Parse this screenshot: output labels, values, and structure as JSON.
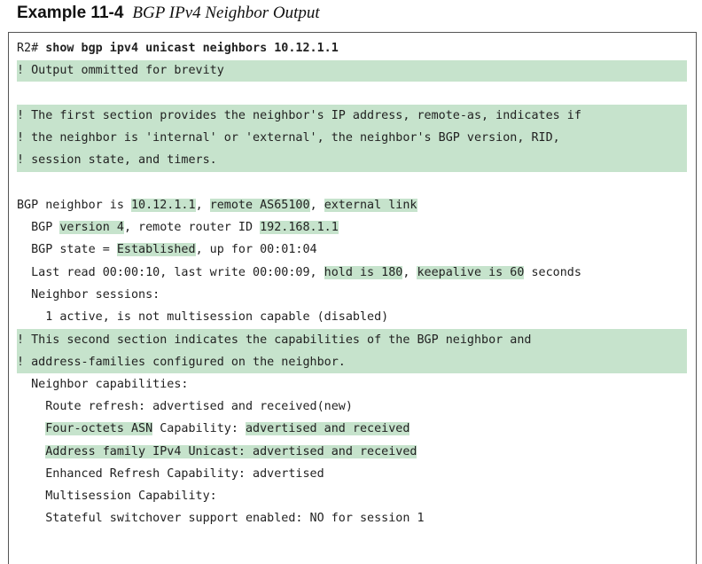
{
  "example": {
    "number": "Example 11-4",
    "caption": "BGP IPv4 Neighbor Output"
  },
  "colors": {
    "highlight": "#c6e3cc",
    "border": "#555555",
    "text": "#222222"
  },
  "terminal": {
    "prompt": "R2#",
    "command": "show bgp ipv4 unicast neighbors 10.12.1.1",
    "comment_omitted": "! Output ommitted for brevity",
    "comment_section1": [
      "! The first section provides the neighbor's IP address, remote-as, indicates if",
      "! the neighbor is 'internal' or 'external', the neighbor's BGP version, RID,",
      "! session state, and timers."
    ],
    "neighbor_line": {
      "prefix": "BGP neighbor is ",
      "ip": "10.12.1.1",
      "sep1": ", ",
      "remote_as": "remote AS65100",
      "sep2": ", ",
      "link": "external link"
    },
    "version_line": {
      "prefix": "  BGP ",
      "version": "version 4",
      "mid": ", remote router ID ",
      "rid": "192.168.1.1"
    },
    "state_line": {
      "prefix": "  BGP state = ",
      "state": "Established",
      "suffix": ", up for 00:01:04"
    },
    "timers_line": {
      "prefix": "  Last read 00:00:10, last write 00:00:09, ",
      "hold": "hold is 180",
      "sep": ", ",
      "keepalive": "keepalive is 60",
      "suffix": " seconds"
    },
    "sessions_label": "  Neighbor sessions:",
    "sessions_value": "    1 active, is not multisession capable (disabled)",
    "comment_section2": [
      "! This second section indicates the capabilities of the BGP neighbor and",
      "! address-families configured on the neighbor."
    ],
    "capabilities_label": "  Neighbor capabilities:",
    "route_refresh": "    Route refresh: advertised and received(new)",
    "four_octet": {
      "prefix": "    ",
      "name": "Four-octets ASN",
      "mid": " Capability: ",
      "value": "advertised and received"
    },
    "af_ipv4": {
      "prefix": "    ",
      "text": "Address family IPv4 Unicast: advertised and received"
    },
    "enhanced_refresh": "    Enhanced Refresh Capability: advertised",
    "multisession": "    Multisession Capability:",
    "stateful": "    Stateful switchover support enabled: NO for session 1"
  }
}
